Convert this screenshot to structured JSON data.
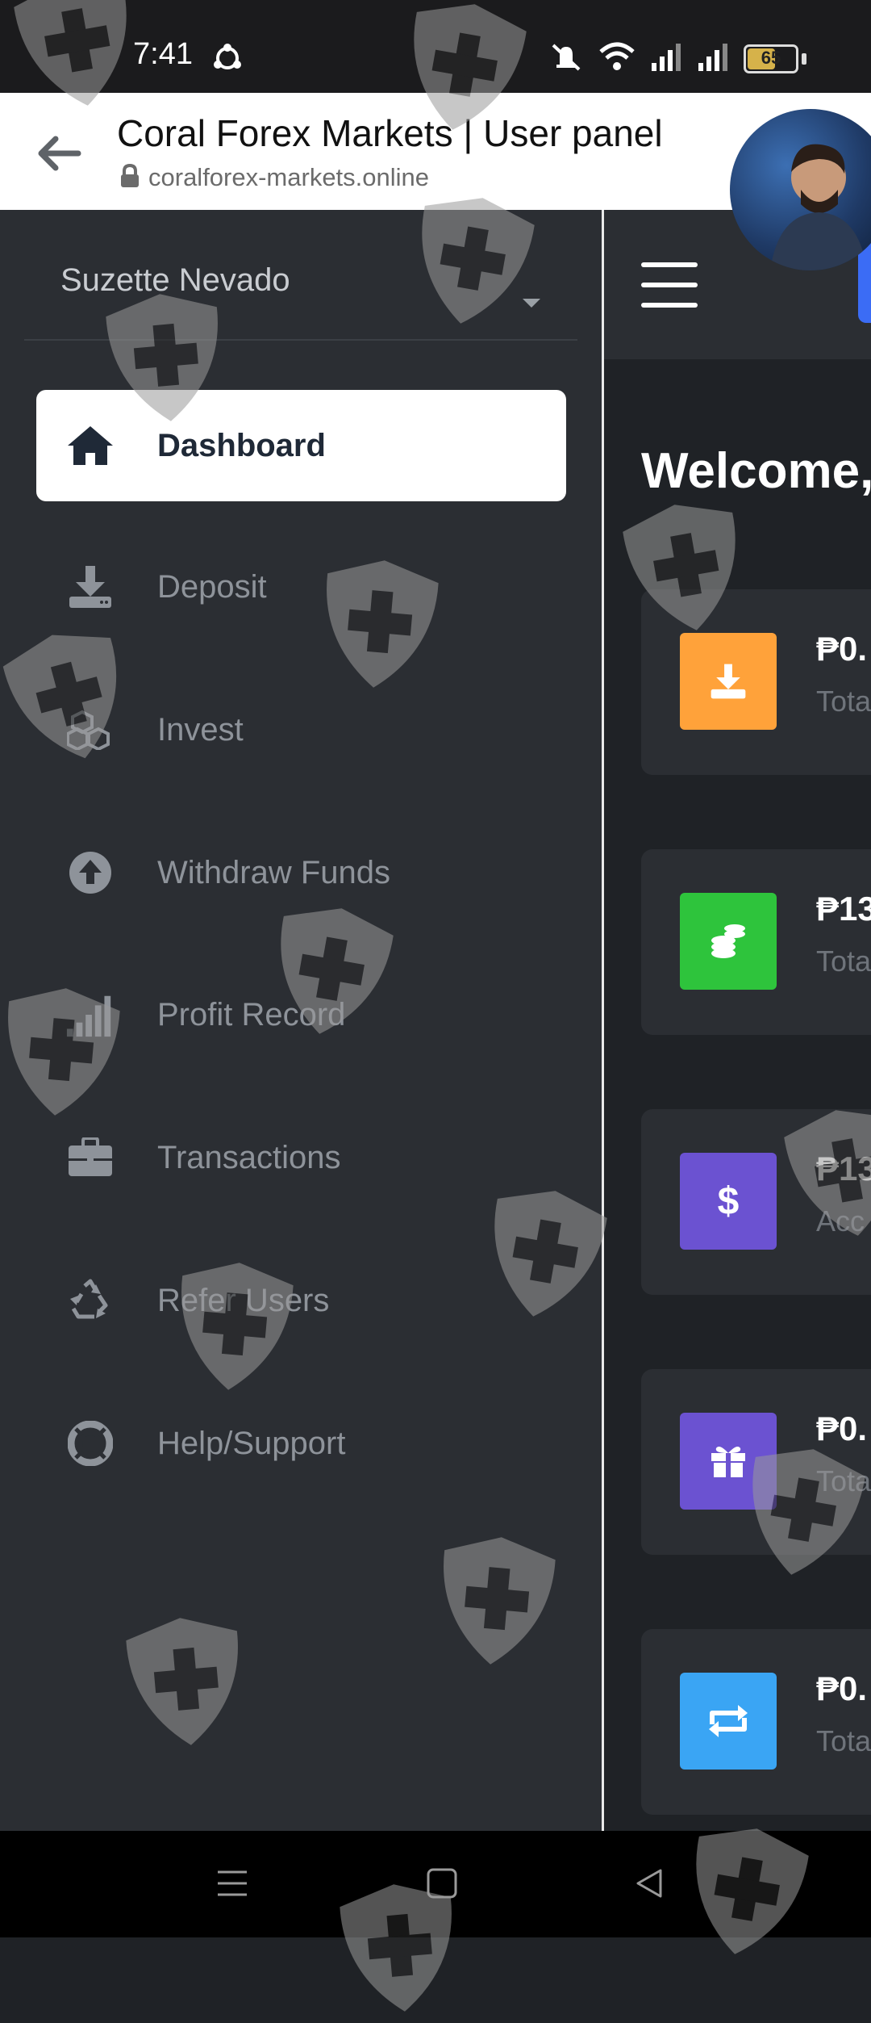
{
  "status_bar": {
    "time": "7:41",
    "battery": "65",
    "battery_level": 0.65
  },
  "browser": {
    "title": "Coral Forex Markets | User panel",
    "url": "coralforex-markets.online"
  },
  "drawer": {
    "user_name": "Suzette Nevado",
    "items": [
      {
        "label": "Dashboard",
        "icon": "home-icon",
        "active": true
      },
      {
        "label": "Deposit",
        "icon": "download-icon",
        "active": false
      },
      {
        "label": "Invest",
        "icon": "cubes-icon",
        "active": false
      },
      {
        "label": "Withdraw Funds",
        "icon": "arrow-up-circle-icon",
        "active": false
      },
      {
        "label": "Profit Record",
        "icon": "signal-bars-icon",
        "active": false
      },
      {
        "label": "Transactions",
        "icon": "briefcase-icon",
        "active": false
      },
      {
        "label": "Refer Users",
        "icon": "recycle-icon",
        "active": false
      },
      {
        "label": "Help/Support",
        "icon": "lifebuoy-icon",
        "active": false
      }
    ]
  },
  "main": {
    "welcome": "Welcome,",
    "cards": [
      {
        "value": "₱0.",
        "label": "Tota",
        "icon": "download-icon",
        "color": "#ffa23a"
      },
      {
        "value": "₱13",
        "label": "Tota",
        "icon": "coins-icon",
        "color": "#2ec43c"
      },
      {
        "value": "₱13",
        "label": "Acc",
        "icon": "dollar-icon",
        "color": "#6b52d1"
      },
      {
        "value": "₱0.",
        "label": "Tota",
        "icon": "gift-icon",
        "color": "#6b52d1"
      },
      {
        "value": "₱0.",
        "label": "Tota",
        "icon": "exchange-icon",
        "color": "#3aa5f4"
      }
    ]
  },
  "colors": {
    "drawer_bg": "#2b2e33",
    "page_bg": "#1f2226",
    "active_item_bg": "#ffffff",
    "watermark": "#8a8a8a"
  }
}
